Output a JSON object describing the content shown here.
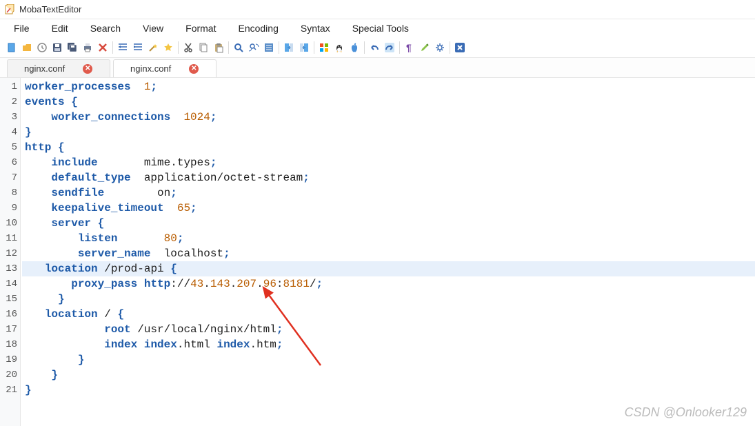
{
  "app": {
    "title": "MobaTextEditor"
  },
  "menu": {
    "file": "File",
    "edit": "Edit",
    "search": "Search",
    "view": "View",
    "format": "Format",
    "encoding": "Encoding",
    "syntax": "Syntax",
    "tools": "Special Tools"
  },
  "tabs": [
    {
      "label": "nginx.conf"
    },
    {
      "label": "nginx.conf"
    }
  ],
  "code": {
    "lines": [
      {
        "n": "1",
        "raw": "worker_processes  1;"
      },
      {
        "n": "2",
        "raw": "events {"
      },
      {
        "n": "3",
        "raw": "    worker_connections  1024;"
      },
      {
        "n": "4",
        "raw": "}"
      },
      {
        "n": "5",
        "raw": "http {"
      },
      {
        "n": "6",
        "raw": "    include       mime.types;"
      },
      {
        "n": "7",
        "raw": "    default_type  application/octet-stream;"
      },
      {
        "n": "8",
        "raw": "    sendfile        on;"
      },
      {
        "n": "9",
        "raw": "    keepalive_timeout  65;"
      },
      {
        "n": "10",
        "raw": "    server {"
      },
      {
        "n": "11",
        "raw": "        listen       80;"
      },
      {
        "n": "12",
        "raw": "        server_name  localhost;"
      },
      {
        "n": "13",
        "raw": "   location /prod-api {",
        "hl": true
      },
      {
        "n": "14",
        "raw": "       proxy_pass http://43.143.207.96:8181/;"
      },
      {
        "n": "15",
        "raw": "     }"
      },
      {
        "n": "16",
        "raw": "   location / {"
      },
      {
        "n": "17",
        "raw": "            root /usr/local/nginx/html;"
      },
      {
        "n": "18",
        "raw": "            index index.html index.htm;"
      },
      {
        "n": "19",
        "raw": "        }"
      },
      {
        "n": "20",
        "raw": "    }"
      },
      {
        "n": "21",
        "raw": "}"
      }
    ]
  },
  "watermark": "CSDN @Onlooker129",
  "icons": {
    "new": "new-file-icon",
    "open": "open-folder-icon",
    "recent": "recent-icon",
    "save": "save-icon",
    "saveall": "save-all-icon",
    "print": "print-icon",
    "close": "close-file-icon",
    "indent": "indent-icon",
    "outdent": "outdent-icon",
    "star1": "star-wand-icon",
    "star2": "star-icon",
    "cut": "cut-icon",
    "copy": "copy-icon",
    "paste": "paste-icon",
    "find": "find-icon",
    "findrep": "find-replace-icon",
    "list": "list-icon",
    "cmp1": "compare-right-icon",
    "cmp2": "compare-left-icon",
    "win": "windows-icon",
    "linux": "linux-icon",
    "mac": "apple-icon",
    "undo": "undo-icon",
    "redo": "redo-icon",
    "para": "paragraph-icon",
    "pencil": "pencil-icon",
    "gear": "gear-icon",
    "x": "xclose-icon"
  }
}
